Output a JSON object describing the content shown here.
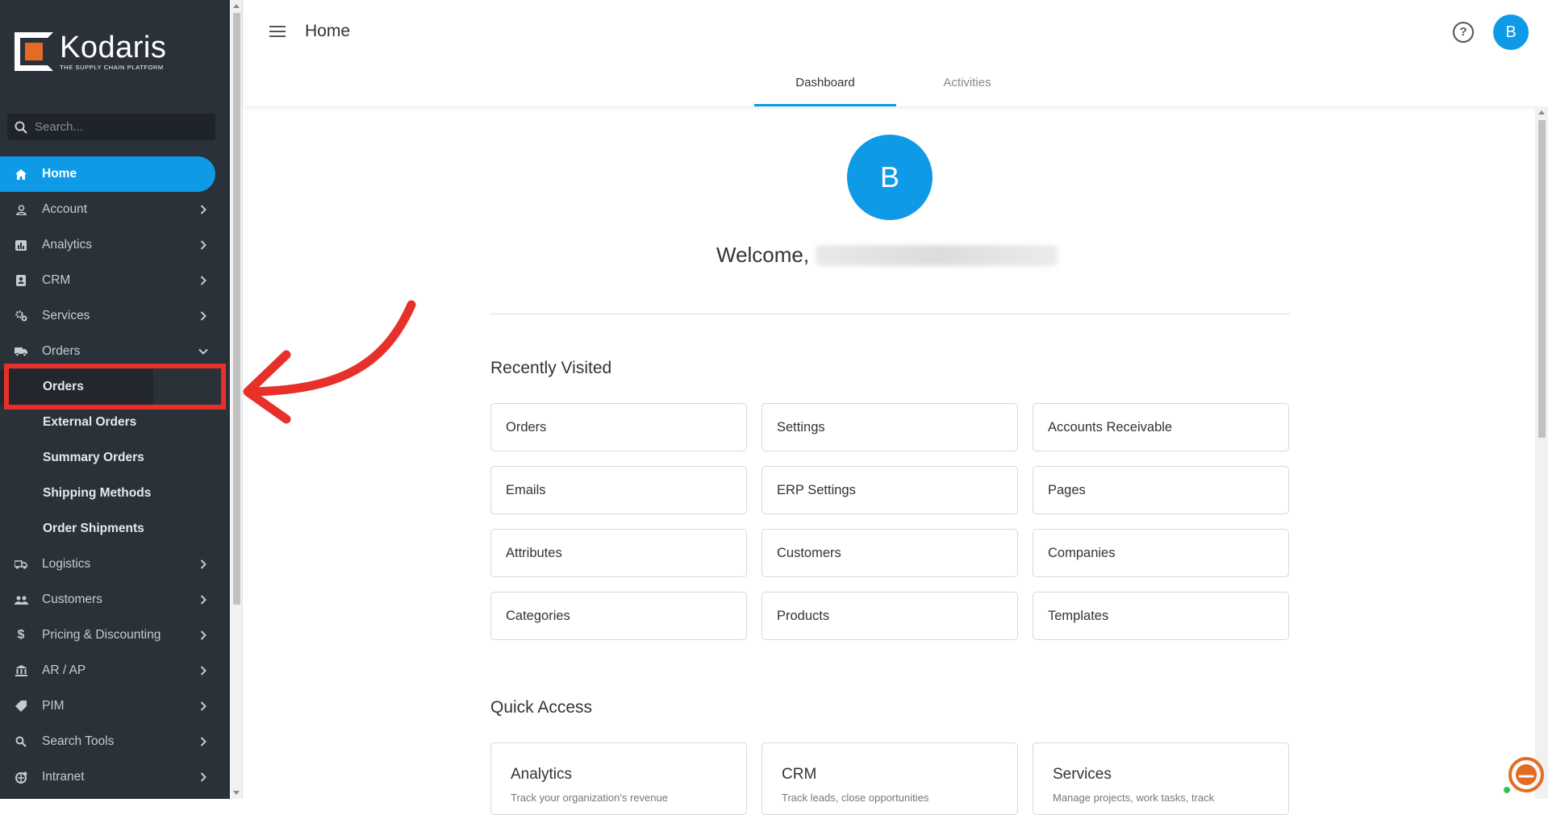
{
  "brand": {
    "name": "Kodaris",
    "tagline": "THE SUPPLY CHAIN PLATFORM",
    "accent_color": "#0e9ae6",
    "logo_color": "#e36b23"
  },
  "sidebar": {
    "search_placeholder": "Search...",
    "items": [
      {
        "label": "Home",
        "icon": "home-icon",
        "active": true
      },
      {
        "label": "Account",
        "icon": "user-icon"
      },
      {
        "label": "Analytics",
        "icon": "analytics-icon"
      },
      {
        "label": "CRM",
        "icon": "crm-icon"
      },
      {
        "label": "Services",
        "icon": "services-icon"
      },
      {
        "label": "Orders",
        "icon": "truck-icon",
        "expanded": true
      }
    ],
    "orders_subitems": [
      "Orders",
      "External Orders",
      "Summary Orders",
      "Shipping Methods",
      "Order Shipments"
    ],
    "items_after": [
      {
        "label": "Logistics",
        "icon": "logistics-icon"
      },
      {
        "label": "Customers",
        "icon": "customers-icon"
      },
      {
        "label": "Pricing & Discounting",
        "icon": "dollar-icon"
      },
      {
        "label": "AR / AP",
        "icon": "bank-icon"
      },
      {
        "label": "PIM",
        "icon": "tag-icon"
      },
      {
        "label": "Search Tools",
        "icon": "search-icon"
      },
      {
        "label": "Intranet",
        "icon": "intranet-icon"
      }
    ]
  },
  "header": {
    "title": "Home",
    "avatar_initial": "B",
    "tabs": [
      "Dashboard",
      "Activities"
    ]
  },
  "main": {
    "avatar_initial": "B",
    "welcome_text": "Welcome,",
    "recently_visited_title": "Recently Visited",
    "recently_visited": [
      "Orders",
      "Settings",
      "Accounts Receivable",
      "Emails",
      "ERP Settings",
      "Pages",
      "Attributes",
      "Customers",
      "Companies",
      "Categories",
      "Products",
      "Templates"
    ],
    "quick_access_title": "Quick Access",
    "quick_access": [
      {
        "title": "Analytics",
        "desc": "Track your organization's revenue"
      },
      {
        "title": "CRM",
        "desc": "Track leads, close opportunities"
      },
      {
        "title": "Services",
        "desc": "Manage projects, work tasks, track"
      }
    ]
  }
}
